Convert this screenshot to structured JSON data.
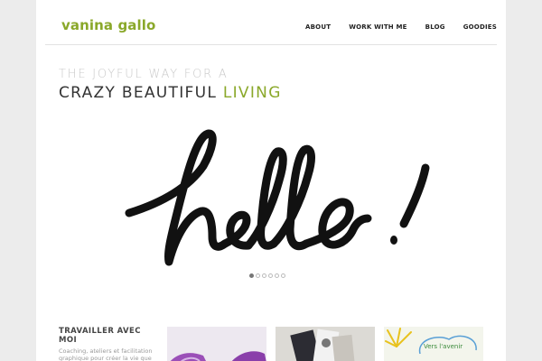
{
  "site": {
    "logo": "vanina gallo"
  },
  "nav": {
    "items": [
      "ABOUT",
      "WORK WITH ME",
      "BLOG",
      "GOODIES"
    ]
  },
  "tagline": {
    "line1": "THE JOYFUL WAY FOR A",
    "line2_main": "CRAZY BEAUTIFUL",
    "line2_accent": "LIVING"
  },
  "hero": {
    "slide_count": 6,
    "active_slide": 1
  },
  "work": {
    "title": "TRAVAILLER AVEC MOI",
    "description": "Coaching, ateliers et facilitation graphique pour créer la vie que vous désirez. Découvrez mes prestations."
  },
  "thumbnails": {
    "third_caption": "Vers l'avenir"
  },
  "colors": {
    "accent": "#8aa82a",
    "text": "#333333",
    "muted": "#c9c9c9"
  }
}
